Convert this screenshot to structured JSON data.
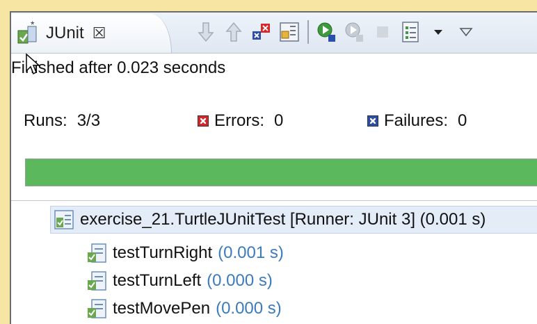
{
  "view": {
    "tab_title": "JUnit",
    "close_glyph": "☒"
  },
  "toolbar": {
    "icons": [
      "next-failure-icon",
      "previous-failure-icon",
      "show-failures-only-icon",
      "scroll-lock-icon",
      "rerun-test-icon",
      "rerun-failed-first-icon",
      "stop-icon",
      "test-run-history-icon",
      "dropdown-arrow-icon",
      "view-menu-icon"
    ]
  },
  "status": {
    "message": "Finished after 0.023 seconds"
  },
  "counts": {
    "runs_label": "Runs:",
    "runs_value": "3/3",
    "errors_label": "Errors:",
    "errors_value": "0",
    "failures_label": "Failures:",
    "failures_value": "0"
  },
  "progress": {
    "fraction": 1.0,
    "color": "#5cb85c"
  },
  "tree": {
    "root": {
      "label": "exercise_21.TurtleJUnitTest [Runner: JUnit 3] (0.001 s)"
    },
    "tests": [
      {
        "name": "testTurnRight",
        "time": "(0.001 s)"
      },
      {
        "name": "testTurnLeft",
        "time": "(0.000 s)"
      },
      {
        "name": "testMovePen",
        "time": "(0.000 s)"
      }
    ]
  },
  "colors": {
    "background": "#f7e6a3",
    "success": "#5cb85c",
    "error_badge": "#d9262a",
    "failure_badge": "#2b4fa8",
    "time_text": "#3a7bbd"
  }
}
